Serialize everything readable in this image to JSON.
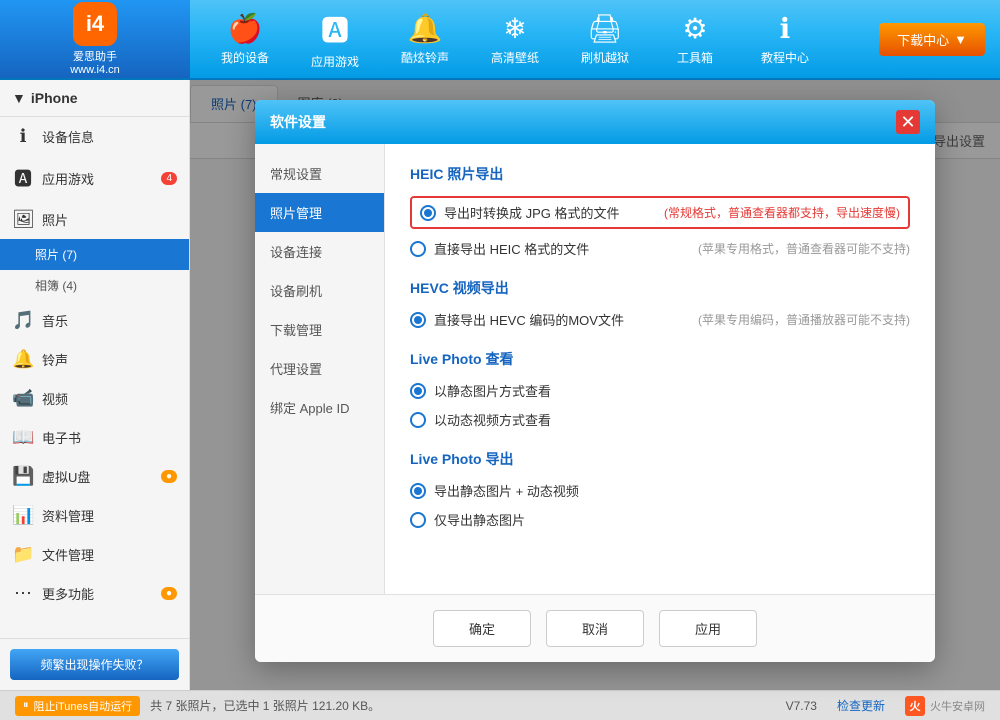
{
  "app": {
    "name": "爱思助手",
    "url": "www.i4.cn",
    "logo_char": "i4"
  },
  "nav": {
    "items": [
      {
        "id": "my-device",
        "icon": "🍎",
        "label": "我的设备"
      },
      {
        "id": "apps-games",
        "icon": "🅰",
        "label": "应用游戏"
      },
      {
        "id": "ringtones",
        "icon": "🔔",
        "label": "酷炫铃声"
      },
      {
        "id": "wallpapers",
        "icon": "❄",
        "label": "高清壁纸"
      },
      {
        "id": "jailbreak",
        "icon": "🖨",
        "label": "刷机越狱"
      },
      {
        "id": "toolbox",
        "icon": "⚙",
        "label": "工具箱"
      },
      {
        "id": "tutorials",
        "icon": "ℹ",
        "label": "教程中心"
      }
    ],
    "download_label": "下载中心"
  },
  "sidebar": {
    "device_name": "iPhone",
    "items": [
      {
        "id": "device-info",
        "icon": "ℹ",
        "label": "设备信息",
        "badge": null
      },
      {
        "id": "apps",
        "icon": "🅰",
        "label": "应用游戏",
        "badge": "4"
      },
      {
        "id": "photos",
        "icon": "🖼",
        "label": "照片",
        "badge": null
      },
      {
        "id": "photos-sub",
        "label": "照片 (7)",
        "sub": true,
        "active": true
      },
      {
        "id": "album-sub",
        "label": "相簿 (4)",
        "sub": true
      },
      {
        "id": "music",
        "icon": "🎵",
        "label": "音乐",
        "badge": null
      },
      {
        "id": "ringtones",
        "icon": "🔔",
        "label": "铃声",
        "badge": null
      },
      {
        "id": "videos",
        "icon": "📹",
        "label": "视频",
        "badge": null
      },
      {
        "id": "ebooks",
        "icon": "📖",
        "label": "电子书",
        "badge": null
      },
      {
        "id": "virtual-disk",
        "icon": "💾",
        "label": "虚拟U盘",
        "badge": "●"
      },
      {
        "id": "data-mgmt",
        "icon": "📊",
        "label": "资料管理",
        "badge": null
      },
      {
        "id": "file-mgmt",
        "icon": "📁",
        "label": "文件管理",
        "badge": null
      },
      {
        "id": "more",
        "icon": "⋯",
        "label": "更多功能",
        "badge": "●"
      }
    ],
    "freq_btn": "频繁出现操作失败？"
  },
  "content": {
    "tabs": [
      {
        "id": "photos-tab",
        "label": "照片 (7)",
        "active": true
      },
      {
        "id": "library-tab",
        "label": "图库 (0)"
      }
    ],
    "toolbar": {
      "export_settings": "导出设置"
    }
  },
  "dialog": {
    "title": "软件设置",
    "sidebar_items": [
      {
        "id": "general",
        "label": "常规设置"
      },
      {
        "id": "photo-mgmt",
        "label": "照片管理",
        "active": true
      },
      {
        "id": "device-conn",
        "label": "设备连接"
      },
      {
        "id": "device-flash",
        "label": "设备刷机"
      },
      {
        "id": "download-mgmt",
        "label": "下载管理"
      },
      {
        "id": "proxy",
        "label": "代理设置"
      },
      {
        "id": "apple-id",
        "label": "绑定 Apple ID"
      }
    ],
    "sections": [
      {
        "id": "heic-export",
        "title": "HEIC 照片导出",
        "options": [
          {
            "id": "heic-opt1",
            "checked": true,
            "text": "导出时转换成 JPG 格式的文件",
            "note": "(常规格式，普通查看器都支持，导出速度慢)",
            "note_type": "red",
            "highlighted": true
          },
          {
            "id": "heic-opt2",
            "checked": false,
            "text": "直接导出 HEIC 格式的文件",
            "note": "(苹果专用格式，普通查看器可能不支持)",
            "note_type": "gray"
          }
        ]
      },
      {
        "id": "hevc-export",
        "title": "HEVC 视频导出",
        "options": [
          {
            "id": "hevc-opt1",
            "checked": true,
            "text": "直接导出 HEVC 编码的MOV文件",
            "note": "(苹果专用编码，普通播放器可能不支持)",
            "note_type": "gray"
          }
        ]
      },
      {
        "id": "live-photo-view",
        "title": "Live Photo 查看",
        "options": [
          {
            "id": "live-opt1",
            "checked": true,
            "text": "以静态图片方式查看",
            "note": "",
            "note_type": ""
          },
          {
            "id": "live-opt2",
            "checked": false,
            "text": "以动态视频方式查看",
            "note": "",
            "note_type": ""
          }
        ]
      },
      {
        "id": "live-photo-export",
        "title": "Live Photo 导出",
        "options": [
          {
            "id": "live-exp1",
            "checked": true,
            "text": "导出静态图片 + 动态视频",
            "note": "",
            "note_type": ""
          },
          {
            "id": "live-exp2",
            "checked": false,
            "text": "仅导出静态图片",
            "note": "",
            "note_type": ""
          }
        ]
      }
    ],
    "buttons": {
      "confirm": "确定",
      "cancel": "取消",
      "apply": "应用"
    }
  },
  "statusbar": {
    "stop_itunes": "阻止iTunes自动运行",
    "photo_info": "共 7 张照片，已选中 1 张照片 121.20 KB。",
    "version": "V7.73",
    "check_update": "检查更新",
    "brand": "火牛安卓网"
  }
}
